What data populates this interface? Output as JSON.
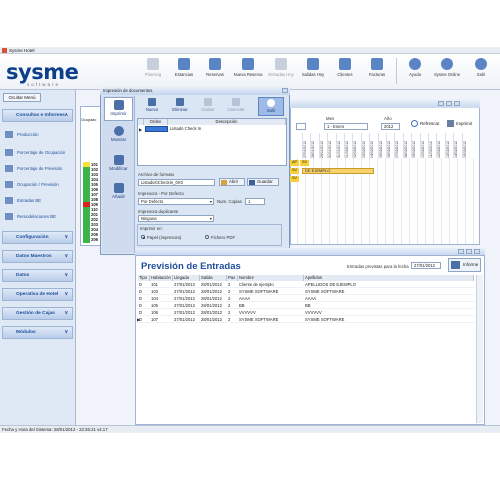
{
  "window": {
    "title": "Sysme Hotel"
  },
  "logo": {
    "name": "sysme",
    "sub": "software"
  },
  "toolbar": [
    {
      "label": "Planning",
      "icon": "planning-icon",
      "enabled": false
    },
    {
      "label": "Estancias",
      "icon": "stays-icon",
      "enabled": true
    },
    {
      "label": "Reservas",
      "icon": "reservations-icon",
      "enabled": true
    },
    {
      "label": "Nueva Reserva",
      "icon": "new-reservation-icon",
      "enabled": true
    },
    {
      "label": "Entradas Hoy",
      "icon": "arrivals-icon",
      "enabled": false
    },
    {
      "label": "Salidas Hoy",
      "icon": "departures-icon",
      "enabled": true
    },
    {
      "label": "Clientes",
      "icon": "clients-icon",
      "enabled": true
    },
    {
      "label": "Facturas",
      "icon": "invoices-icon",
      "enabled": true
    },
    {
      "label": "Ayuda",
      "icon": "help-icon",
      "enabled": true
    },
    {
      "label": "Sysme Online",
      "icon": "online-icon",
      "enabled": true
    },
    {
      "label": "Salir",
      "icon": "exit-icon",
      "enabled": true
    }
  ],
  "sidebar": {
    "hide_label": "Ocultar Menú",
    "categories": [
      {
        "label": "Consultas e Informes",
        "chevron": "∧"
      },
      {
        "label": "Configuración",
        "chevron": "∨"
      },
      {
        "label": "Datos Maestros",
        "chevron": "∨"
      },
      {
        "label": "Datos",
        "chevron": "∨"
      },
      {
        "label": "Operativa de Hotel",
        "chevron": "∨"
      },
      {
        "label": "Gestión de Cajas",
        "chevron": "∨"
      },
      {
        "label": "Módulos",
        "chevron": "∨"
      }
    ],
    "items": [
      {
        "label": "Producción"
      },
      {
        "label": "Porcentaje de Ocupación"
      },
      {
        "label": "Porcentaje de Previsión"
      },
      {
        "label": "Ocupación / Previsión"
      },
      {
        "label": "Entradas BE"
      },
      {
        "label": "Remodelaciones BE"
      }
    ]
  },
  "planning": {
    "mes_label": "Mes",
    "mes_value": "1 - Enero",
    "anio_label": "Año",
    "anio_value": "2012",
    "refresh_label": "Refrescar",
    "print_label": "Imprimir",
    "dates": [
      "27/01/2012",
      "28/01/2012",
      "29/01/2012",
      "30/01/2012",
      "31/01/2012",
      "01/02/2012",
      "02/02/2012",
      "03/02/2012",
      "04/02/2012",
      "05/02/2012",
      "06/02/2012",
      "07/02/2012",
      "08/02/2012",
      "09/02/2012",
      "10/02/2012",
      "11/02/2012",
      "12/02/2012",
      "13/02/2012",
      "14/02/2012",
      "15/02/2012"
    ],
    "booking_label": "DE EJEMPLO",
    "tags": [
      "AP",
      "SV",
      "SV",
      "SV"
    ],
    "occupancy_header": "Ocupado"
  },
  "strip": {
    "rooms": [
      "101",
      "102",
      "103",
      "104",
      "105",
      "106",
      "107",
      "108",
      "109",
      "110",
      "201",
      "202",
      "203",
      "204",
      "205",
      "206"
    ],
    "colors": [
      "#f6e23a",
      "#3bb54a",
      "#3bb54a",
      "#3bb54a",
      "#3bb54a",
      "#3bb54a",
      "#3bb54a",
      "#3bb54a",
      "#e02020",
      "#3bb54a",
      "#3bb54a",
      "#3bb54a",
      "#3bb54a",
      "#3bb54a",
      "#3bb54a",
      "#3bb54a"
    ]
  },
  "dialog": {
    "title": "Impresión de documentos",
    "side_buttons": [
      {
        "label": "Imprimir",
        "icon": "printer-icon"
      },
      {
        "label": "Mostrar",
        "icon": "magnifier-icon"
      },
      {
        "label": "Modificar",
        "icon": "pencil-icon"
      },
      {
        "label": "Añadir",
        "icon": "add-doc-icon"
      }
    ],
    "top_buttons": [
      {
        "label": "Nuevo",
        "icon": "plus-icon",
        "enabled": true
      },
      {
        "label": "Eliminar",
        "icon": "minus-icon",
        "enabled": true
      },
      {
        "label": "Grabar",
        "icon": "save-icon",
        "enabled": false
      },
      {
        "label": "Cancelar",
        "icon": "cancel-icon",
        "enabled": false
      },
      {
        "label": "Salir",
        "icon": "exit-icon",
        "enabled": true
      }
    ],
    "list_headers": [
      "Orden",
      "Descripción"
    ],
    "list_rows": [
      {
        "orden": "1",
        "descripcion": "Listado Check In"
      }
    ],
    "file_label": "Archivo de formato",
    "file_value": "Listados\\CheckIn_0X0",
    "open_label": "Abrir",
    "save_label": "Guardar",
    "printer_label": "Impresora - Por Defecto",
    "printer_value": "Por Defecto",
    "copies_label": "Num. Copias",
    "copies_value": "1",
    "dup_label": "Impresora duplicante",
    "dup_value": "Ninguna",
    "print_in_label": "Imprimir en:",
    "opt_paper": "Papel (impresora)",
    "opt_pdf": "Fichero PDF"
  },
  "preview": {
    "title": "Previsión de Entradas",
    "date_label": "Entradas previstas para la fecha",
    "date_value": "27/01/2012",
    "report_label": "Informe",
    "headers": [
      "Tipo",
      "Habitación",
      "Llegada",
      "Salida",
      "Pax",
      "Nombre",
      "Apellidos"
    ],
    "rows": [
      [
        "D",
        "101",
        "27/01/2012",
        "28/01/2012",
        "2",
        "Cliente de ejemplo",
        "APELLIDOS DE EJEMPLO"
      ],
      [
        "D",
        "103",
        "27/01/2012",
        "28/01/2012",
        "2",
        "SYSME SOFTWARE",
        "SYSME SOFTWARE"
      ],
      [
        "D",
        "104",
        "27/01/2012",
        "28/01/2012",
        "2",
        "AAAA",
        "AAAA"
      ],
      [
        "D",
        "105",
        "27/01/2012",
        "28/01/2012",
        "2",
        "BB",
        "BB"
      ],
      [
        "D",
        "106",
        "27/01/2012",
        "28/01/2012",
        "2",
        "VVVVVV",
        "VVVVVV"
      ],
      [
        "D",
        "107",
        "27/01/2012",
        "28/01/2012",
        "2",
        "SYSME SOFTWARE",
        "SYSME SOFTWARE"
      ]
    ]
  },
  "status": {
    "text": "Fecha y Hora del Sistema: 28/01/2012 - 22:26:21 v4.17"
  }
}
